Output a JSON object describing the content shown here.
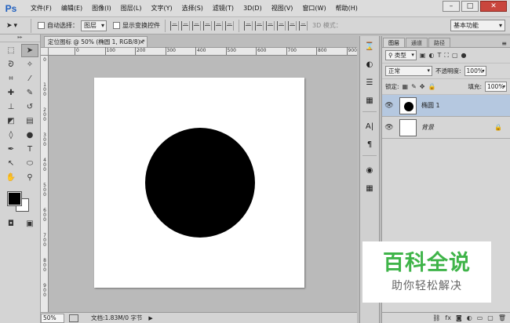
{
  "app": {
    "logo": "Ps"
  },
  "menubar": {
    "items": [
      "文件(F)",
      "编辑(E)",
      "图像(I)",
      "图层(L)",
      "文字(Y)",
      "选择(S)",
      "滤镜(T)",
      "3D(D)",
      "视图(V)",
      "窗口(W)",
      "帮助(H)"
    ],
    "window_controls": [
      "minimize-icon",
      "restore-icon",
      "close-icon"
    ]
  },
  "options_bar": {
    "auto_select_label": "自动选择：",
    "auto_select_target": "图层",
    "show_transform_label": "显示变换控件",
    "mode_3d_label": "3D 模式：",
    "workspace": "基本功能"
  },
  "document": {
    "tab_title": "定位图标 @ 50% (椭圆 1, RGB/8) *",
    "ruler_h_labels": [
      "0",
      "100",
      "200",
      "300",
      "400",
      "500",
      "600",
      "700",
      "800",
      "900"
    ],
    "ruler_v_labels": [
      "0",
      "1 0 0",
      "2 0 0",
      "3 0 0",
      "4 0 0",
      "5 0 0",
      "6 0 0",
      "7 0 0",
      "8 0 0",
      "9 0 0"
    ],
    "canvas_bg": "#ffffff",
    "shape_color": "#000000"
  },
  "status": {
    "zoom": "50%",
    "doc_size": "文档:1.83M/0 字节"
  },
  "layers_panel": {
    "tabs": [
      "图层",
      "通道",
      "路径"
    ],
    "filter_kind": "类型",
    "blend_mode": "正常",
    "opacity_label": "不透明度:",
    "opacity": "100%",
    "lock_label": "锁定:",
    "fill_label": "填充:",
    "fill": "100%",
    "layers": [
      {
        "name": "椭圆 1",
        "selected": true
      },
      {
        "name": "背景",
        "selected": false,
        "locked": true
      }
    ],
    "footer_icons": [
      "link-icon",
      "fx-icon",
      "mask-icon",
      "adjustment-icon",
      "group-icon",
      "new-layer-icon",
      "trash-icon"
    ]
  },
  "watermark": {
    "title": "百科全说",
    "subtitle": "助你轻松解决"
  },
  "colors": {
    "foreground": "#000000",
    "background": "#ffffff",
    "selected_layer": "#b5c8e0",
    "watermark_green": "#3fb449"
  }
}
